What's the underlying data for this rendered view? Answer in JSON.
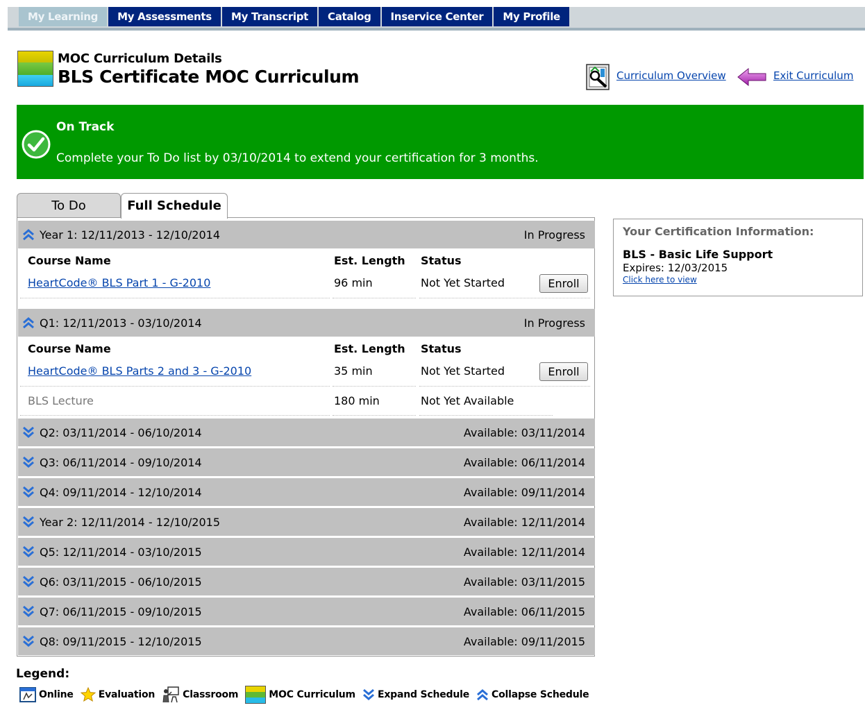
{
  "nav": {
    "tabs": [
      {
        "label": "My Learning",
        "active": true
      },
      {
        "label": "My Assessments"
      },
      {
        "label": "My Transcript"
      },
      {
        "label": "Catalog"
      },
      {
        "label": "Inservice Center"
      },
      {
        "label": "My Profile"
      }
    ]
  },
  "header": {
    "subtitle": "MOC Curriculum Details",
    "title": "BLS Certificate MOC Curriculum",
    "overview_link": "Curriculum Overview",
    "exit_link": "Exit Curriculum"
  },
  "banner": {
    "title": "On Track",
    "message": "Complete your To Do list by 03/10/2014 to extend your certification for 3 months.",
    "color": "#009900"
  },
  "schedule_tabs": {
    "todo": "To Do",
    "full": "Full Schedule",
    "active": "full"
  },
  "columns": {
    "course_name": "Course Name",
    "est_length": "Est. Length",
    "status": "Status"
  },
  "expanded": [
    {
      "label": "Year 1:  12/11/2013 - 12/10/2014",
      "state": "In Progress",
      "courses": [
        {
          "name": "HeartCode® BLS Part 1 - G-2010",
          "length": "96 min",
          "status": "Not Yet Started",
          "action": "Enroll"
        }
      ]
    },
    {
      "label": "Q1:  12/11/2013 - 03/10/2014",
      "state": "In Progress",
      "courses": [
        {
          "name": "HeartCode® BLS Parts 2 and 3 - G-2010",
          "length": "35 min",
          "status": "Not Yet Started",
          "action": "Enroll"
        },
        {
          "name": "BLS Lecture",
          "length": "180 min",
          "status": "Not Yet Available"
        }
      ]
    }
  ],
  "collapsed": [
    {
      "label": "Q2:  03/11/2014 - 06/10/2014",
      "available": "Available: 03/11/2014"
    },
    {
      "label": "Q3:  06/11/2014 - 09/10/2014",
      "available": "Available: 06/11/2014"
    },
    {
      "label": "Q4:  09/11/2014 - 12/10/2014",
      "available": "Available: 09/11/2014"
    },
    {
      "label": "Year 2:  12/11/2014 - 12/10/2015",
      "available": "Available: 12/11/2014"
    },
    {
      "label": "Q5:  12/11/2014 - 03/10/2015",
      "available": "Available: 12/11/2014"
    },
    {
      "label": "Q6:  03/11/2015 - 06/10/2015",
      "available": "Available: 03/11/2015"
    },
    {
      "label": "Q7:  06/11/2015 - 09/10/2015",
      "available": "Available: 06/11/2015"
    },
    {
      "label": "Q8:  09/11/2015 - 12/10/2015",
      "available": "Available: 09/11/2015"
    }
  ],
  "certification": {
    "heading": "Your Certification Information:",
    "name": "BLS - Basic Life Support",
    "expires": "Expires: 12/03/2015",
    "link": "Click here to view"
  },
  "legend": {
    "title": "Legend:",
    "items": [
      {
        "icon": "online-icon",
        "label": "Online"
      },
      {
        "icon": "evaluation-star-icon",
        "label": "Evaluation"
      },
      {
        "icon": "classroom-icon",
        "label": "Classroom"
      },
      {
        "icon": "moc-curriculum-icon",
        "label": "MOC Curriculum"
      },
      {
        "icon": "expand-chevron-icon",
        "label": "Expand Schedule"
      },
      {
        "icon": "collapse-chevron-icon",
        "label": "Collapse Schedule"
      }
    ]
  },
  "colors": {
    "nav_tab": "#00247d",
    "nav_tab_active": "#a9c4cf",
    "link": "#0645ad",
    "row_header": "#c0c0c0",
    "chevron": "#2a6fd6"
  }
}
